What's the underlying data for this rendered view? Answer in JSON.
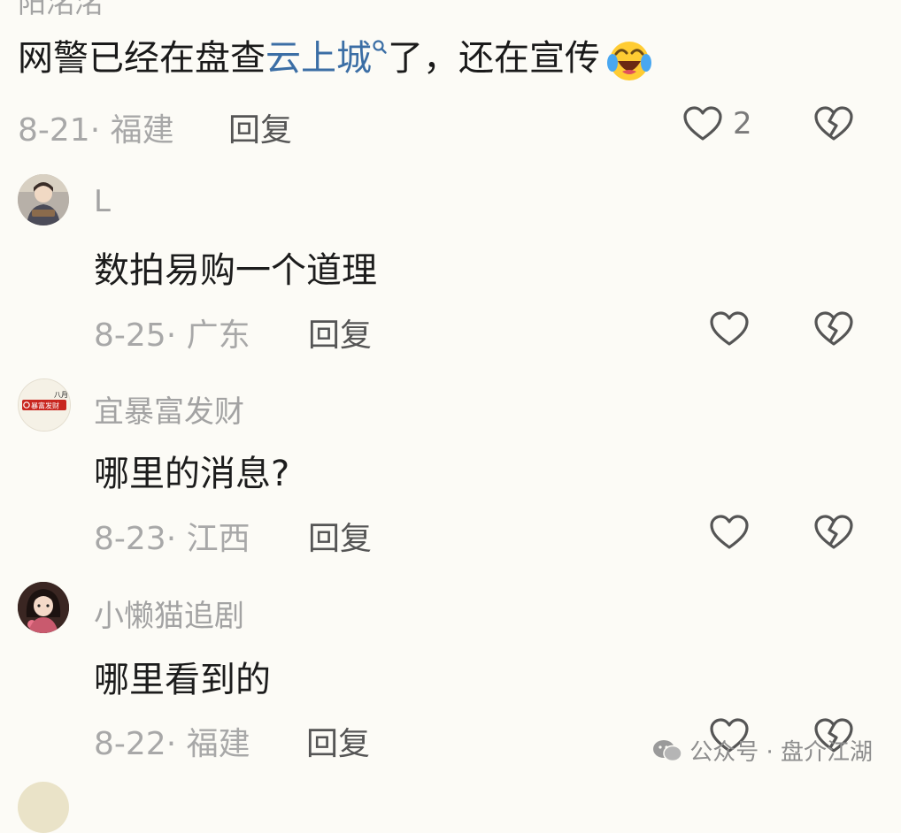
{
  "top_comment": {
    "user_cut": "阳洺洺",
    "text_before": "网警已经在盘查",
    "link": "云上城",
    "text_after": "了，还在宣传",
    "date": "8-21",
    "region": "福建",
    "reply": "回复",
    "likes": "2"
  },
  "comments": [
    {
      "user": "L",
      "text": "数拍易购一个道理",
      "date": "8-25",
      "region": "广东",
      "reply": "回复"
    },
    {
      "user": "宜暴富发财",
      "avatar_text_top": "八月",
      "avatar_text": "暴富发财",
      "text": "哪里的消息?",
      "date": "8-23",
      "region": "江西",
      "reply": "回复"
    },
    {
      "user": "小懒猫追剧",
      "text": "哪里看到的",
      "date": "8-22",
      "region": "福建",
      "reply": "回复"
    }
  ],
  "watermark": "公众号 · 盘介江湖",
  "icons": {
    "like": "heart-outline-icon",
    "dislike": "broken-heart-icon",
    "search": "search-icon",
    "emoji": "laughing-crying-emoji-icon"
  }
}
